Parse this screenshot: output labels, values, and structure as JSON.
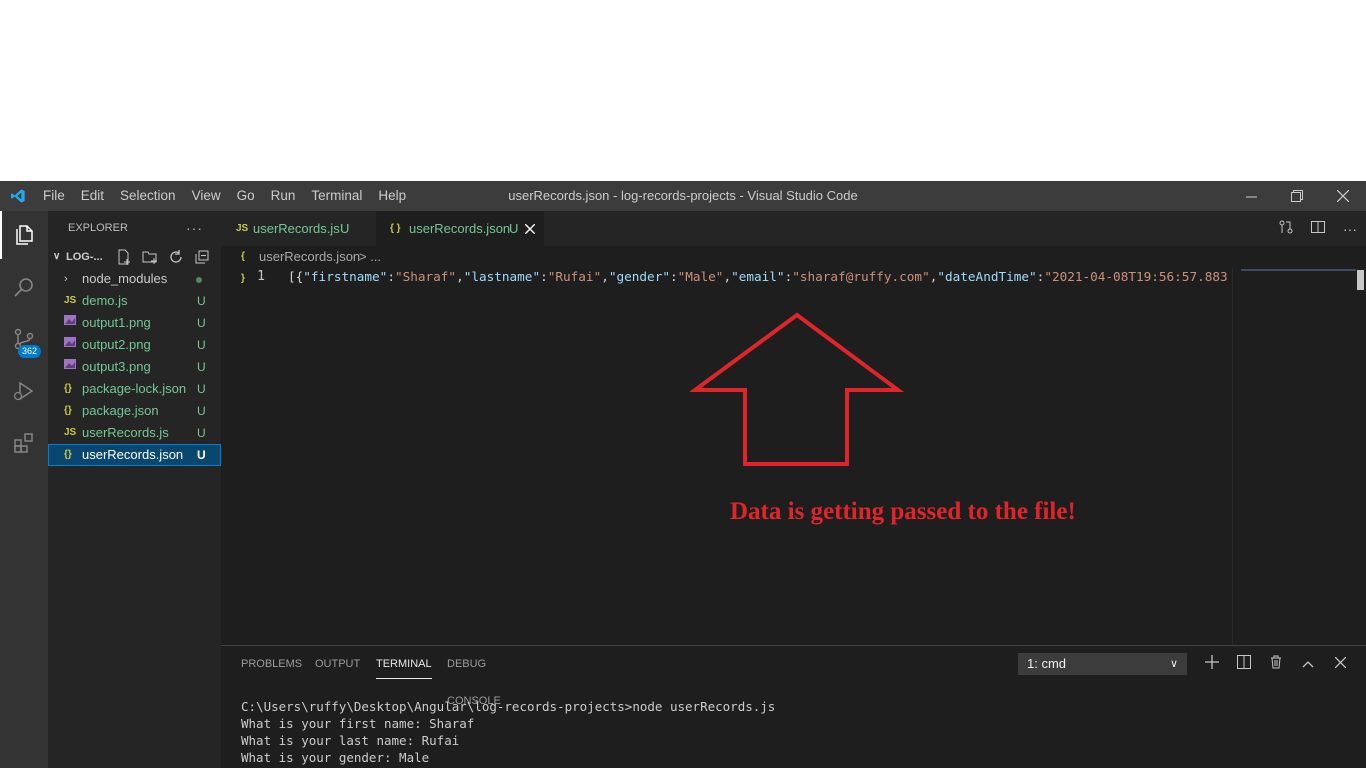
{
  "window": {
    "title": "userRecords.json - log-records-projects - Visual Studio Code",
    "menu": [
      "File",
      "Edit",
      "Selection",
      "View",
      "Go",
      "Run",
      "Terminal",
      "Help"
    ]
  },
  "activity": {
    "scm_badge": "362"
  },
  "explorer": {
    "header": "EXPLORER",
    "more": "···",
    "folder": "LOG-...",
    "items": [
      {
        "icon": "",
        "name": "node_modules",
        "status": ""
      },
      {
        "icon": "JS",
        "name": "demo.js",
        "status": "U"
      },
      {
        "icon": "img",
        "name": "output1.png",
        "status": "U"
      },
      {
        "icon": "img",
        "name": "output2.png",
        "status": "U"
      },
      {
        "icon": "img",
        "name": "output3.png",
        "status": "U"
      },
      {
        "icon": "{}",
        "name": "package-lock.json",
        "status": "U"
      },
      {
        "icon": "{}",
        "name": "package.json",
        "status": "U"
      },
      {
        "icon": "JS",
        "name": "userRecords.js",
        "status": "U"
      },
      {
        "icon": "{}",
        "name": "userRecords.json",
        "status": "U"
      }
    ]
  },
  "tabs": [
    {
      "icon": "JS",
      "label": "userRecords.js",
      "status": "U"
    },
    {
      "icon": "{ }",
      "label": "userRecords.json",
      "status": "U"
    }
  ],
  "breadcrumb": {
    "icon": "{ }",
    "file": "userRecords.json",
    "sep": "> ..."
  },
  "editor": {
    "line_number": "1",
    "tokens": [
      {
        "t": "p",
        "v": "[{"
      },
      {
        "t": "k",
        "v": "\"firstname\""
      },
      {
        "t": "p",
        "v": ":"
      },
      {
        "t": "s",
        "v": "\"Sharaf\""
      },
      {
        "t": "p",
        "v": ","
      },
      {
        "t": "k",
        "v": "\"lastname\""
      },
      {
        "t": "p",
        "v": ":"
      },
      {
        "t": "s",
        "v": "\"Rufai\""
      },
      {
        "t": "p",
        "v": ","
      },
      {
        "t": "k",
        "v": "\"gender\""
      },
      {
        "t": "p",
        "v": ":"
      },
      {
        "t": "s",
        "v": "\"Male\""
      },
      {
        "t": "p",
        "v": ","
      },
      {
        "t": "k",
        "v": "\"email\""
      },
      {
        "t": "p",
        "v": ":"
      },
      {
        "t": "s",
        "v": "\"sharaf@ruffy.com\""
      },
      {
        "t": "p",
        "v": ","
      },
      {
        "t": "k",
        "v": "\"dateAndTime\""
      },
      {
        "t": "p",
        "v": ":"
      },
      {
        "t": "s",
        "v": "\"2021-04-08T19:56:57.883"
      }
    ]
  },
  "panel": {
    "tabs": [
      "PROBLEMS",
      "OUTPUT",
      "TERMINAL",
      "DEBUG CONSOLE"
    ],
    "terminal_select": "1: cmd",
    "terminal_lines": [
      "C:\\Users\\ruffy\\Desktop\\Angular\\log-records-projects>node userRecords.js",
      "What is your first name: Sharaf",
      "What is your last name: Rufai",
      "What is your gender: Male"
    ]
  },
  "annotation": {
    "text": "Data is getting passed to the file!",
    "color": "#e0252a"
  },
  "colors": {
    "untracked": "#73c991",
    "accent": "#007acc"
  }
}
